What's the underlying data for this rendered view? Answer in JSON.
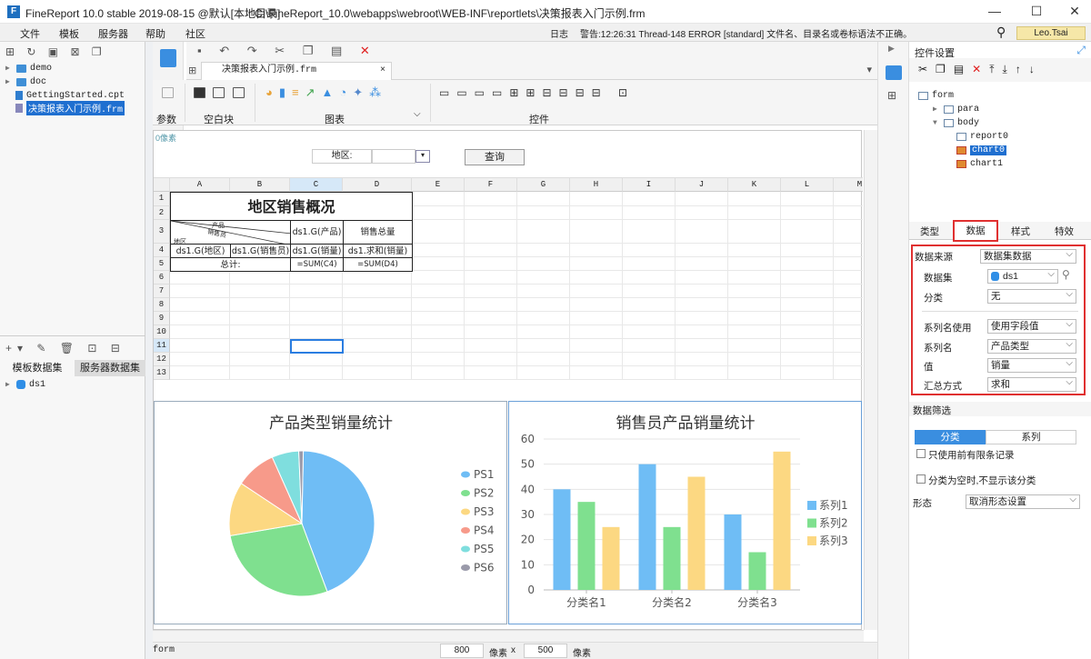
{
  "window": {
    "app_title": "FineReport 10.0 stable 2019-08-15 @默认[本地目录]",
    "file_path": "C:\\FineReport_10.0\\webapps\\webroot\\WEB-INF\\reportlets\\决策报表入门示例.frm",
    "minimize": "—",
    "maximize": "☐",
    "close": "✕"
  },
  "menubar": {
    "items": [
      "文件",
      "模板",
      "服务器",
      "帮助",
      "社区"
    ],
    "log_label": "日志",
    "warning_text": "警告:12:26:31 Thread-148 ERROR [standard] 文件名、目录名或卷标语法不正确。",
    "user": "Leo.Tsai"
  },
  "left_panel": {
    "tree": [
      {
        "label": "demo",
        "type": "folder"
      },
      {
        "label": "doc",
        "type": "folder"
      },
      {
        "label": "GettingStarted.cpt",
        "type": "cpt"
      },
      {
        "label": "决策报表入门示例.frm",
        "type": "frm",
        "selected": true
      }
    ],
    "dataset_tabs": [
      "模板数据集",
      "服务器数据集"
    ],
    "datasets": [
      "ds1"
    ]
  },
  "tabs": {
    "active_doc": "决策报表入门示例.frm",
    "close": "×"
  },
  "ribbon": {
    "groups": [
      "参数",
      "空白块",
      "图表",
      "控件"
    ]
  },
  "canvas": {
    "param_pixel_label": "0像素",
    "area_label": "地区:",
    "query_button": "查询",
    "columns": [
      "A",
      "B",
      "C",
      "D",
      "E",
      "F",
      "G",
      "H",
      "I",
      "J",
      "K",
      "L",
      "M"
    ],
    "rows": [
      "1",
      "2",
      "3",
      "4",
      "5",
      "6",
      "7",
      "8",
      "9",
      "10",
      "11",
      "12",
      "13"
    ],
    "report": {
      "title": "地区销售概况",
      "diag_product": "产品",
      "diag_salesman": "销售员",
      "diag_area": "地区",
      "c3": "ds1.G(产品)",
      "d3": "销售总量",
      "a4": "ds1.G(地区)",
      "b4": "ds1.G(销售员)",
      "c4": "ds1.G(销量)",
      "d4": "ds1.求和(销量)",
      "total_label": "总计:",
      "c5": "=SUM(C4)",
      "d5": "=SUM(D4)"
    }
  },
  "chart_data": [
    {
      "type": "pie",
      "title": "产品类型销量统计",
      "categories": [
        "PS1",
        "PS2",
        "PS3",
        "PS4",
        "PS5",
        "PS6"
      ],
      "values": [
        44,
        28,
        12,
        9,
        6,
        1
      ],
      "colors": [
        "#6fbdf5",
        "#7fe08f",
        "#fcd882",
        "#f79a8a",
        "#7fdede",
        "#9a9aaa"
      ],
      "legend": "right"
    },
    {
      "type": "bar",
      "title": "销售员产品销量统计",
      "categories": [
        "分类名1",
        "分类名2",
        "分类名3"
      ],
      "series": [
        {
          "name": "系列1",
          "values": [
            40,
            50,
            30
          ],
          "color": "#6fbdf5"
        },
        {
          "name": "系列2",
          "values": [
            35,
            25,
            15
          ],
          "color": "#7fe08f"
        },
        {
          "name": "系列3",
          "values": [
            25,
            45,
            55
          ],
          "color": "#fcd882"
        }
      ],
      "yticks": [
        "0",
        "10",
        "20",
        "30",
        "40",
        "50",
        "60"
      ],
      "ylim": [
        0,
        60
      ],
      "grid": true,
      "legend": "right"
    }
  ],
  "status": {
    "mode": "form",
    "width": "800",
    "height": "500",
    "unit": "像素",
    "times": "x"
  },
  "right_panel": {
    "title": "控件设置",
    "tree": [
      {
        "label": "form",
        "level": 0
      },
      {
        "label": "para",
        "level": 1
      },
      {
        "label": "body",
        "level": 1
      },
      {
        "label": "report0",
        "level": 2
      },
      {
        "label": "chart0",
        "level": 2,
        "selected": true
      },
      {
        "label": "chart1",
        "level": 2
      }
    ],
    "prop_tabs": [
      "类型",
      "数据",
      "样式",
      "特效"
    ],
    "active_tab": "数据",
    "fields": {
      "source_label": "数据来源",
      "source_value": "数据集数据",
      "dataset_label": "数据集",
      "dataset_value": "ds1",
      "category_label": "分类",
      "category_value": "无",
      "series_use_label": "系列名使用",
      "series_use_value": "使用字段值",
      "series_name_label": "系列名",
      "series_name_value": "产品类型",
      "value_label": "值",
      "value_value": "销量",
      "agg_label": "汇总方式",
      "agg_value": "求和"
    },
    "filter_title": "数据筛选",
    "filter_tabs": [
      "分类",
      "系列"
    ],
    "check1": "只使用前有限条记录",
    "check2": "分类为空时,不显示该分类",
    "form_label": "形态",
    "form_value": "取消形态设置"
  }
}
